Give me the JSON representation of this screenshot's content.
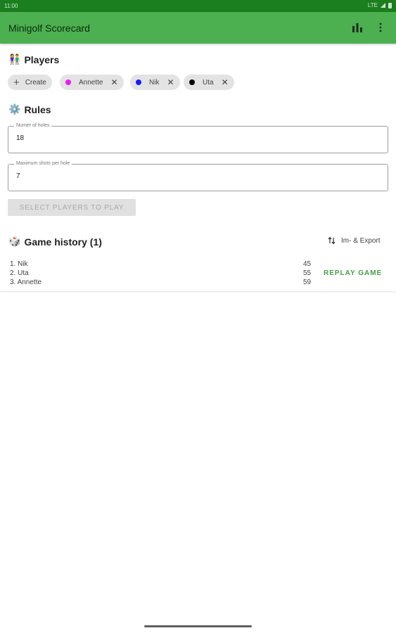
{
  "status_bar": {
    "time": "11:00",
    "network": "LTE"
  },
  "app_bar": {
    "title": "Minigolf Scorecard",
    "stats_icon": "bar-chart-icon",
    "more_icon": "more-vert-icon"
  },
  "players": {
    "emoji": "👫",
    "title": "Players",
    "create_label": "Create",
    "chips": [
      {
        "name": "Annette",
        "color": "#e91ef0"
      },
      {
        "name": "Nik",
        "color": "#1a1aff"
      },
      {
        "name": "Uta",
        "color": "#000000"
      }
    ]
  },
  "rules": {
    "emoji": "⚙️",
    "title": "Rules",
    "holes": {
      "label": "Numer of holes",
      "value": "18"
    },
    "max_shots": {
      "label": "Maximum shots per hole",
      "value": "7"
    },
    "action": "SELECT PLAYERS TO PLAY"
  },
  "history": {
    "emoji": "🎲",
    "title": "Game history (1)",
    "export_label": "Im- & Export",
    "games": [
      {
        "ranking": [
          {
            "rank": "1. Nik",
            "score": "45"
          },
          {
            "rank": "2. Uta",
            "score": "55"
          },
          {
            "rank": "3. Annette",
            "score": "59"
          }
        ],
        "replay_label": "REPLAY GAME"
      }
    ]
  }
}
